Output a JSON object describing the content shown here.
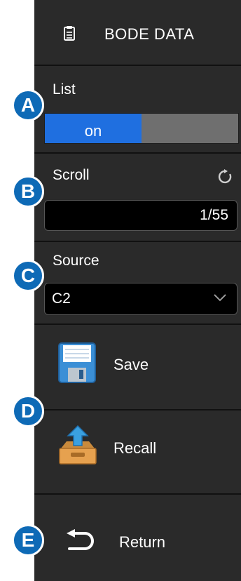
{
  "header": {
    "title": "BODE DATA",
    "icon": "clipboard-icon"
  },
  "list": {
    "label": "List",
    "on_label": "on",
    "state": "on"
  },
  "scroll": {
    "label": "Scroll",
    "value": "1/55",
    "icon": "refresh-icon"
  },
  "source": {
    "label": "Source",
    "value": "C2",
    "icon": "chevron-down-icon"
  },
  "actions": {
    "save": {
      "label": "Save",
      "icon": "floppy-disk-icon"
    },
    "recall": {
      "label": "Recall",
      "icon": "tray-upload-icon"
    },
    "return": {
      "label": "Return",
      "icon": "return-arrow-icon"
    }
  },
  "markers": [
    "A",
    "B",
    "C",
    "D",
    "E"
  ],
  "colors": {
    "panel": "#2a2a2a",
    "toggle_on": "#1f6fe0",
    "toggle_off": "#6f6f6f",
    "marker": "#0e6ab6"
  }
}
